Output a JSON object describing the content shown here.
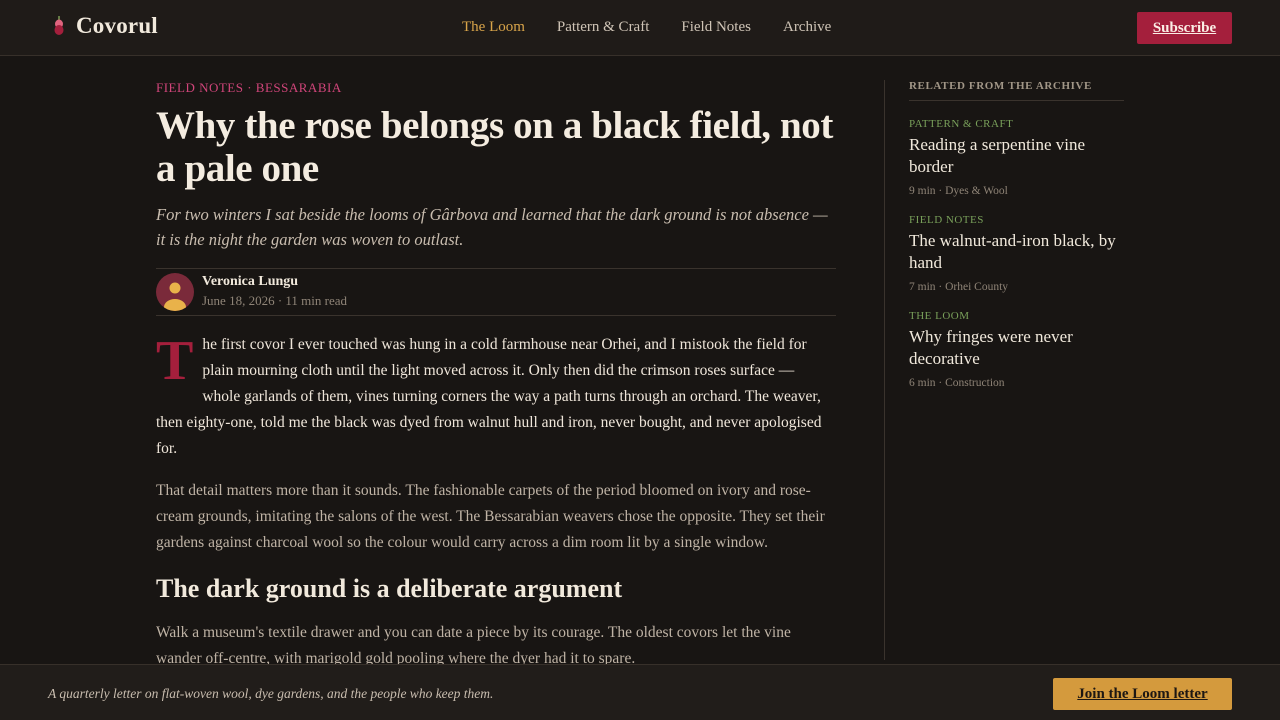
{
  "brand": {
    "name": "Covorul",
    "icon": "rose-icon"
  },
  "nav": {
    "items": [
      {
        "label": "The Loom",
        "active": true
      },
      {
        "label": "Pattern & Craft",
        "active": false
      },
      {
        "label": "Field Notes",
        "active": false
      },
      {
        "label": "Archive",
        "active": false
      }
    ],
    "subscribe_label": "Subscribe"
  },
  "article": {
    "kicker": "FIELD NOTES · BESSARABIA",
    "title": "Why the rose belongs on a black field, not a pale one",
    "dek": "For two winters I sat beside the looms of Gârbova and learned that the dark ground is not absence — it is the night the garden was woven to outlast.",
    "author": "Veronica Lungu",
    "meta": "June 18, 2026 · 11 min read",
    "dropcap": "T",
    "para1": "he first covor I ever touched was hung in a cold farmhouse near Orhei, and I mistook the field for plain mourning cloth until the light moved across it. Only then did the crimson roses surface — whole garlands of them, vines turning corners the way a path turns through an orchard. The weaver, then eighty-one, told me the black was dyed from walnut hull and iron, never bought, and never apologised for.",
    "para2": "That detail matters more than it sounds. The fashionable carpets of the period bloomed on ivory and rose-cream grounds, imitating the salons of the west. The Bessarabian weavers chose the opposite. They set their gardens against charcoal wool so the colour would carry across a dim room lit by a single window.",
    "subhead": "The dark ground is a deliberate argument",
    "para3": "Walk a museum's textile drawer and you can date a piece by its courage. The oldest covors let the vine wander off-centre, with marigold gold pooling where the dyer had it to spare."
  },
  "sidebar": {
    "heading": "RELATED FROM THE ARCHIVE",
    "items": [
      {
        "tag": "PATTERN & CRAFT",
        "title": "Reading a serpentine vine border",
        "meta": "9 min · Dyes & Wool"
      },
      {
        "tag": "FIELD NOTES",
        "title": "The walnut-and-iron black, by hand",
        "meta": "7 min · Orhei County"
      },
      {
        "tag": "THE LOOM",
        "title": "Why fringes were never decorative",
        "meta": "6 min · Construction"
      }
    ]
  },
  "footer": {
    "tagline": "A quarterly letter on flat-woven wool, dye gardens, and the people who keep them.",
    "cta_label": "Join the Loom letter"
  },
  "colors": {
    "background": "#181513",
    "accent_crimson": "#a41f3c",
    "accent_gold": "#d49a3d",
    "kicker_pink": "#d0457a",
    "tag_green": "#79a05a",
    "nav_active": "#d9a54a"
  }
}
